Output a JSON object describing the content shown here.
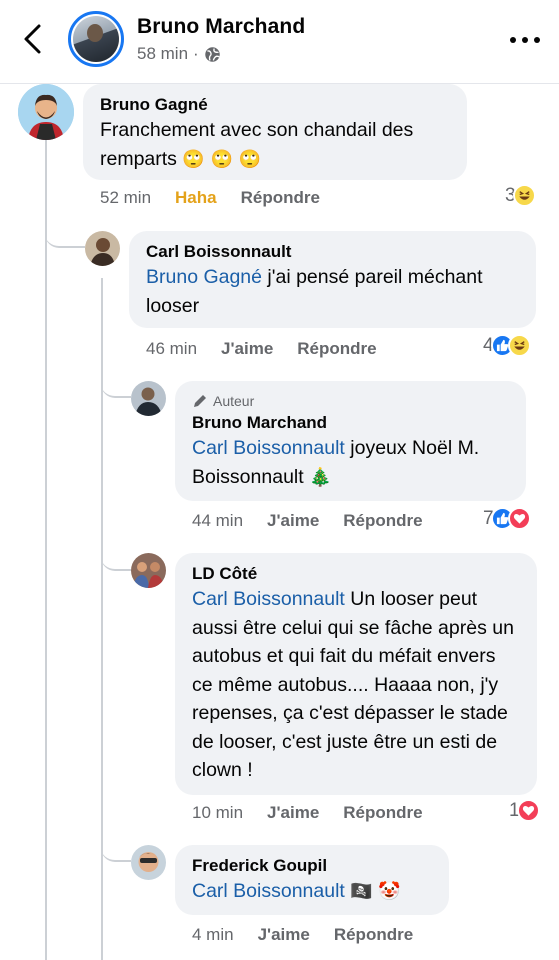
{
  "header": {
    "title": "Bruno Marchand",
    "time": "58 min",
    "separator": "·"
  },
  "comments": [
    {
      "author": "Bruno Gagné",
      "mention": "",
      "text": "Franchement avec son chandail des remparts",
      "emojis": "🙄 🙄 🙄",
      "time": "52 min",
      "reaction_label": "Haha",
      "reply_label": "Répondre",
      "reaction_count": "3",
      "reaction_icons": [
        "haha-reaction-icon"
      ]
    },
    {
      "author": "Carl Boissonnault",
      "mention": "Bruno Gagné",
      "text": " j'ai pensé pareil méchant looser",
      "time": "46 min",
      "like_label": "J'aime",
      "reply_label": "Répondre",
      "reaction_count": "4",
      "reaction_icons": [
        "like-reaction-icon",
        "haha-reaction-icon"
      ]
    },
    {
      "author_badge": "Auteur",
      "author": "Bruno Marchand",
      "mention": "Carl Boissonnault",
      "text": " joyeux Noël M. Boissonnault",
      "emojis": "🎄",
      "time": "44 min",
      "like_label": "J'aime",
      "reply_label": "Répondre",
      "reaction_count": "7",
      "reaction_icons": [
        "like-reaction-icon",
        "love-reaction-icon"
      ]
    },
    {
      "author": "LD Côté",
      "mention": "Carl Boissonnault",
      "text": " Un looser peut aussi être celui qui se fâche après un autobus et qui fait du méfait envers ce même autobus.... Haaaa non, j'y repenses, ça c'est dépasser le stade de looser, c'est juste être un esti de clown !",
      "time": "10 min",
      "like_label": "J'aime",
      "reply_label": "Répondre",
      "reaction_count": "1",
      "reaction_icons": [
        "love-reaction-icon"
      ]
    },
    {
      "author": "Frederick Goupil",
      "mention": "Carl Boissonnault",
      "text": "",
      "emojis": "🏴‍☠️ 🤡",
      "time": "4 min",
      "like_label": "J'aime",
      "reply_label": "Répondre"
    }
  ],
  "colors": {
    "mention": "#1b5fa8",
    "bubble": "#f0f2f5",
    "haha_active": "#e4a21a",
    "story_ring": "#1877f2"
  }
}
